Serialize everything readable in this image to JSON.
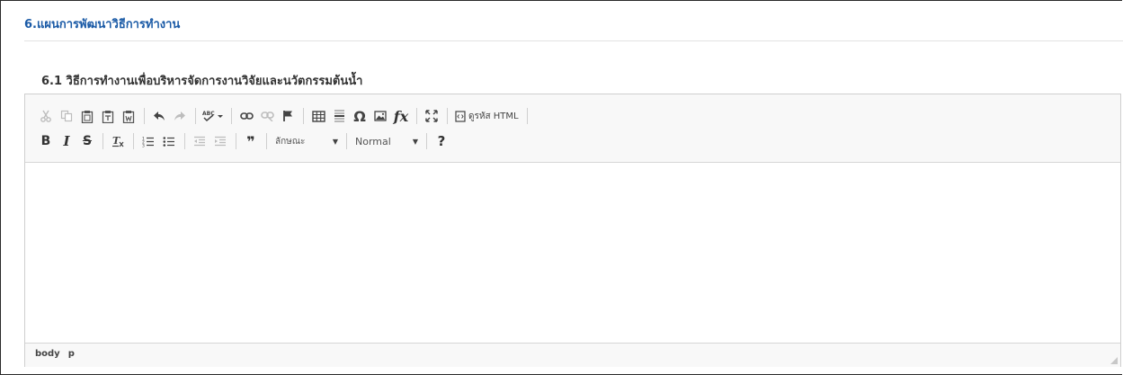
{
  "section": {
    "title": "6.แผนการพัฒนาวิธีการทำงาน"
  },
  "field": {
    "label": "6.1 วิธีการทำงานเพื่อบริหารจัดการงานวิจัยและนวัตกรรมต้นน้ำ"
  },
  "toolbar": {
    "source_label": "ดูรหัส HTML",
    "bold_label": "B",
    "italic_label": "I",
    "strike_label": "S",
    "blockquote_label": "❞",
    "styles_combo": {
      "value": "ลักษณะ",
      "arrow": "▼"
    },
    "format_combo": {
      "value": "Normal",
      "arrow": "▼"
    },
    "help_label": "?",
    "icons": {
      "cut": "cut-icon",
      "copy": "copy-icon",
      "paste": "paste-icon",
      "paste_text": "paste-text-icon",
      "paste_word": "paste-from-word-icon",
      "undo": "undo-icon",
      "redo": "redo-icon",
      "spellcheck": "spellcheck-icon",
      "link": "link-icon",
      "unlink": "unlink-icon",
      "anchor": "anchor-flag-icon",
      "table": "table-icon",
      "hr": "horizontal-line-icon",
      "special_char": "omega-icon",
      "image": "image-icon",
      "math": "fx-icon",
      "maximize": "maximize-icon",
      "source": "source-icon",
      "remove_format": "remove-format-icon",
      "numbered_list": "numbered-list-icon",
      "bulleted_list": "bulleted-list-icon",
      "outdent": "outdent-icon",
      "indent": "indent-icon"
    }
  },
  "statusbar": {
    "path": [
      "body",
      "p"
    ]
  },
  "colors": {
    "section_title": "#1a5aa6",
    "toolbar_bg": "#f8f8f8",
    "border": "#cfcfcf"
  }
}
